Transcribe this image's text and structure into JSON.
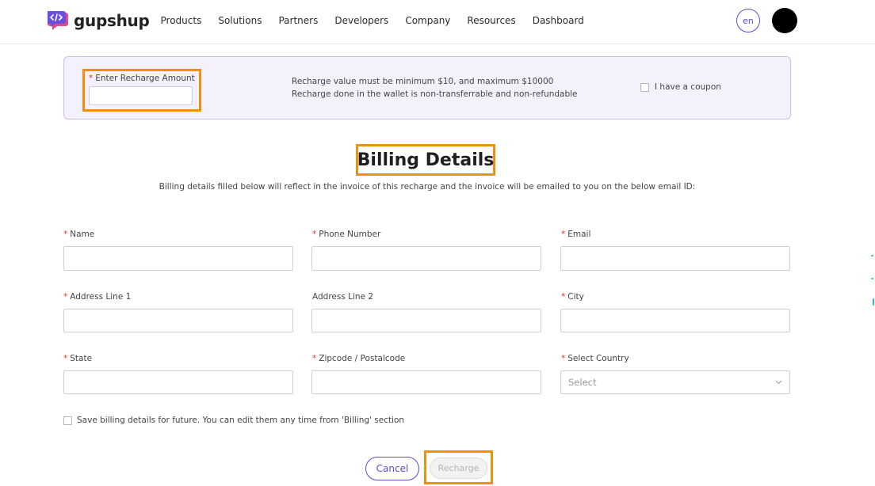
{
  "header": {
    "logo_text": "gupshup",
    "nav": [
      "Products",
      "Solutions",
      "Partners",
      "Developers",
      "Company",
      "Resources",
      "Dashboard"
    ],
    "lang": "en"
  },
  "recharge": {
    "amount_label": "Enter Recharge Amount",
    "amount_value": "",
    "info_line1": "Recharge value must be minimum $10, and maximum $10000",
    "info_line2": "Recharge done in the wallet is non-transferrable and non-refundable",
    "coupon_label": "I have a coupon"
  },
  "billing": {
    "title": "Billing Details",
    "subtitle": "Billing details filled below will reflect in the invoice of this recharge and the invoice will be emailed to you on the below email ID:",
    "fields": {
      "name": "Name",
      "phone": "Phone Number",
      "email": "Email",
      "address1": "Address Line 1",
      "address2": "Address Line 2",
      "city": "City",
      "state": "State",
      "zipcode": "Zipcode / Postalcode",
      "country": "Select Country"
    },
    "country_placeholder": "Select",
    "save_label": "Save billing details for future. You can edit them any time from 'Billing' section"
  },
  "actions": {
    "cancel": "Cancel",
    "recharge": "Recharge"
  },
  "colors": {
    "accent": "#5f4bd4",
    "highlight": "#f0900f",
    "required": "#e3342f",
    "panel_bg": "#f4f1fd"
  }
}
